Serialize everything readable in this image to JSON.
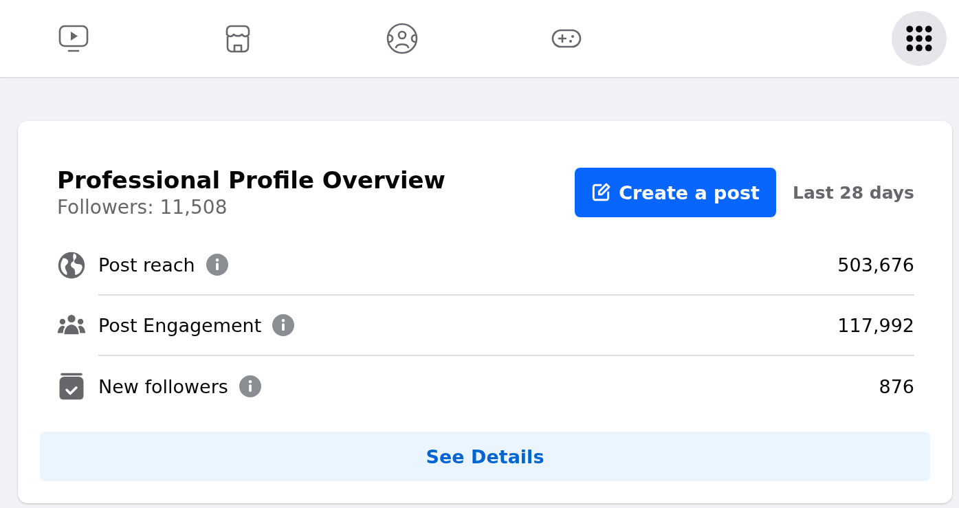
{
  "nav": {
    "items": [
      {
        "kind": "video"
      },
      {
        "kind": "store"
      },
      {
        "kind": "groups"
      },
      {
        "kind": "gaming"
      }
    ],
    "menu": {
      "kind": "apps"
    }
  },
  "card": {
    "title": "Professional Profile Overview",
    "followers": "Followers: 11,508",
    "create_button": "Create a post",
    "period": "Last 28 days",
    "metrics": [
      {
        "kind": "globe",
        "label": "Post reach",
        "value": "503,676"
      },
      {
        "kind": "people",
        "label": "Post Engagement",
        "value": "117,992"
      },
      {
        "kind": "box",
        "label": "New followers",
        "value": "876"
      }
    ],
    "details_button": "See Details"
  }
}
